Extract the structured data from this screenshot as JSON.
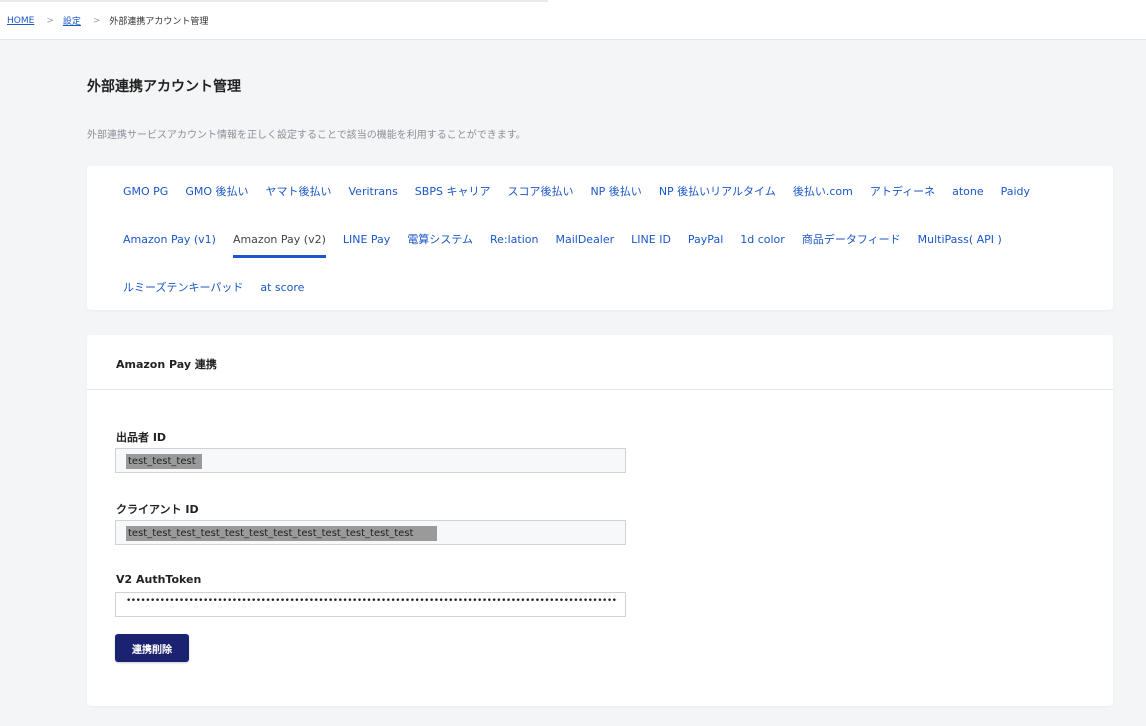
{
  "breadcrumb": {
    "home": "HOME",
    "settings": "設定",
    "current": "外部連携アカウント管理",
    "separator": ">"
  },
  "page": {
    "title": "外部連携アカウント管理",
    "description": "外部連携サービスアカウント情報を正しく設定することで該当の機能を利用することができます。"
  },
  "tabs": {
    "row1": [
      "GMO PG",
      "GMO 後払い",
      "ヤマト後払い",
      "Veritrans",
      "SBPS キャリア",
      "スコア後払い",
      "NP 後払い",
      "NP 後払いリアルタイム",
      "後払い.com",
      "アトディーネ",
      "atone",
      "Paidy"
    ],
    "row2": [
      "Amazon Pay (v1)",
      "Amazon Pay (v2)",
      "LINE Pay",
      "電算システム",
      "Re:lation",
      "MailDealer",
      "LINE ID",
      "PayPal",
      "1d color",
      "商品データフィード",
      "MultiPass( API )"
    ],
    "row3": [
      "ルミーズテンキーパッド",
      "at score"
    ],
    "active": "Amazon Pay (v2)"
  },
  "form": {
    "title": "Amazon Pay 連携",
    "seller_id": {
      "label": "出品者 ID",
      "value": "test_test_test"
    },
    "client_id": {
      "label": "クライアント ID",
      "value": "test_test_test_test_test_test_test_test_test_test_test_test"
    },
    "auth_token": {
      "label": "V2 AuthToken",
      "value": "•••••••••••••••••••••••••••••••••••••••••••••••••••••••••••••••••••••••••••••••••••••••••••••••••••••••••••••••••••••••••••••••••••"
    },
    "delete_button": "連携削除"
  },
  "colors": {
    "link": "#1a57c8",
    "button": "#1b2370",
    "background": "#f4f5f7"
  }
}
